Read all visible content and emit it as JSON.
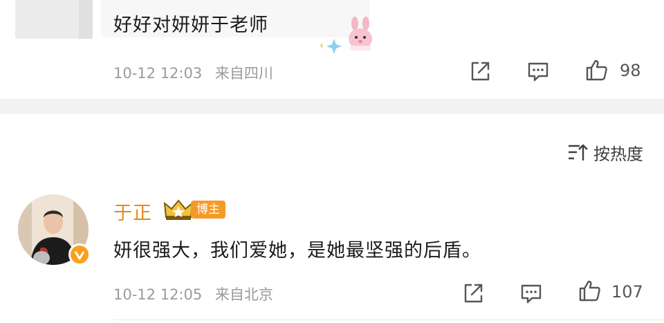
{
  "top_comment": {
    "text": "好好对妍妍于老师",
    "time": "10-12 12:03",
    "location": "来自四川",
    "like_count": "98"
  },
  "sort": {
    "label": "按热度"
  },
  "comment": {
    "username": "于正",
    "badge": "博主",
    "text": "妍很强大，我们爱她，是她最坚强的后盾。",
    "time": "10-12 12:05",
    "location": "来自北京",
    "like_count": "107"
  },
  "colors": {
    "username": "#e78a16",
    "badge_bg": "#f59a29",
    "meta": "#9a9a9a",
    "divider": "#f2f2f2"
  },
  "icons": [
    "share-icon",
    "comment-icon",
    "like-icon",
    "sort-icon",
    "verified-icon",
    "crown-icon"
  ]
}
